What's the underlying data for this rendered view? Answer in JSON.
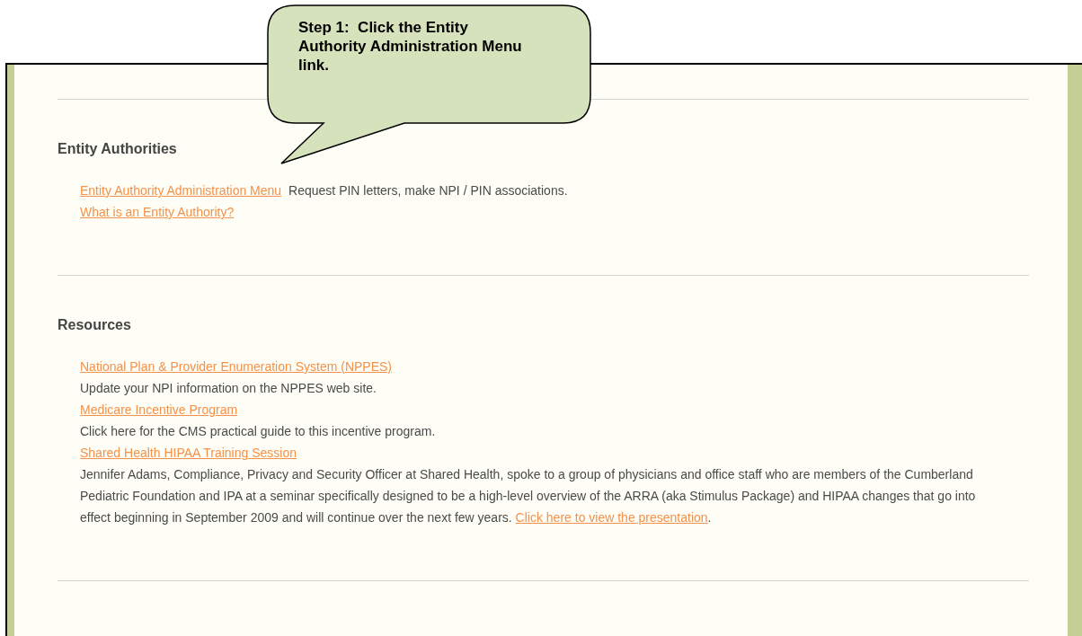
{
  "callout": {
    "text": "Step 1:  Click the Entity Authority Administration Menu link."
  },
  "sections": [
    {
      "heading": "Entity Authorities",
      "items": [
        {
          "kind": "inline",
          "link": "Entity Authority Administration Menu",
          "description": "Request PIN letters, make NPI / PIN associations."
        },
        {
          "kind": "inline",
          "link": "What is an Entity Authority?"
        }
      ]
    },
    {
      "heading": "Resources",
      "items": [
        {
          "kind": "stacked",
          "link": "National Plan & Provider Enumeration System (NPPES)",
          "description": "Update your NPI information on the NPPES web site."
        },
        {
          "kind": "stacked",
          "link": "Medicare Incentive Program",
          "description": "Click here for the CMS practical guide to this incentive program."
        },
        {
          "kind": "stacked",
          "link": "Shared Health HIPAA Training Session",
          "description": "Jennifer Adams, Compliance, Privacy and Security Officer at Shared Health, spoke to a group of physicians and office staff who are members of the Cumberland Pediatric Foundation and IPA at a seminar specifically designed to be a high-level overview of the ARRA (aka Stimulus Package) and HIPAA changes that go into effect beginning in September 2009 and will continue over the next few years.",
          "description_link": "Click here to view the presentation",
          "description_end": "."
        }
      ]
    }
  ]
}
